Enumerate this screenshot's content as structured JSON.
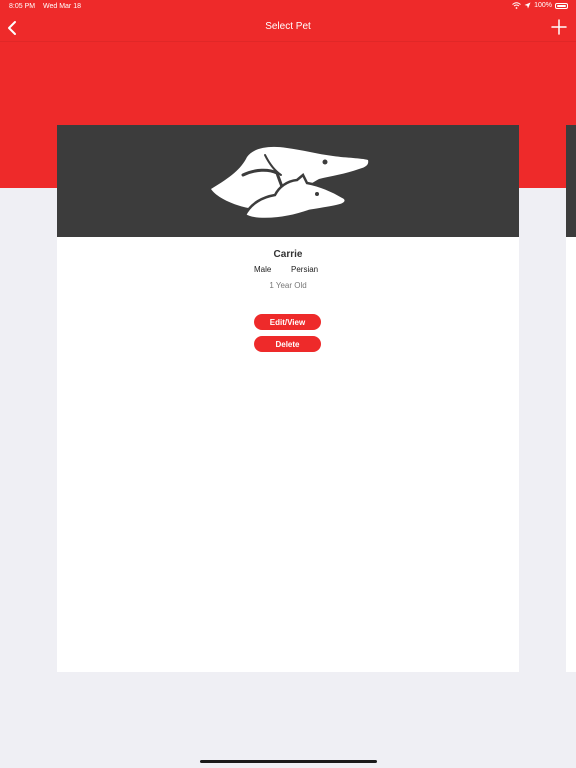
{
  "status_bar": {
    "time": "8:05 PM",
    "date": "Wed Mar 18",
    "battery": "100%"
  },
  "nav": {
    "title": "Select Pet",
    "back_icon": "chevron-left-icon",
    "add_icon": "plus-icon"
  },
  "colors": {
    "accent": "#ee2a2a",
    "header_dark": "#3c3c3c",
    "background": "#efeff4"
  },
  "pet": {
    "name": "Carrie",
    "gender": "Male",
    "breed": "Persian",
    "age": "1 Year Old"
  },
  "actions": {
    "edit_label": "Edit/View",
    "delete_label": "Delete"
  }
}
